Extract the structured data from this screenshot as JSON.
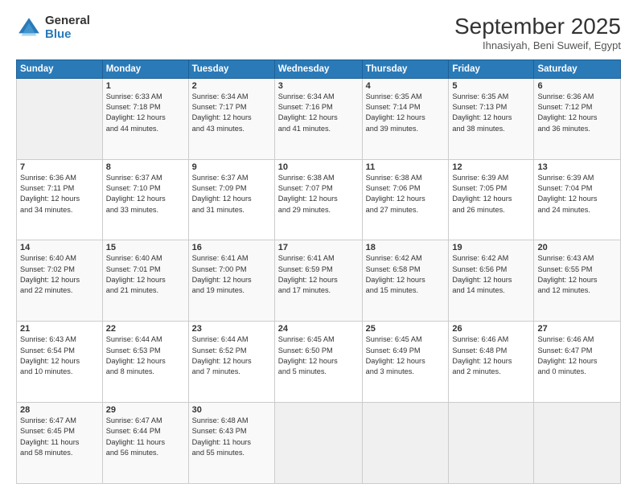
{
  "logo": {
    "general": "General",
    "blue": "Blue"
  },
  "header": {
    "month": "September 2025",
    "subtitle": "Ihnasiyah, Beni Suweif, Egypt"
  },
  "days": [
    "Sunday",
    "Monday",
    "Tuesday",
    "Wednesday",
    "Thursday",
    "Friday",
    "Saturday"
  ],
  "weeks": [
    [
      {
        "num": "",
        "text": ""
      },
      {
        "num": "1",
        "text": "Sunrise: 6:33 AM\nSunset: 7:18 PM\nDaylight: 12 hours\nand 44 minutes."
      },
      {
        "num": "2",
        "text": "Sunrise: 6:34 AM\nSunset: 7:17 PM\nDaylight: 12 hours\nand 43 minutes."
      },
      {
        "num": "3",
        "text": "Sunrise: 6:34 AM\nSunset: 7:16 PM\nDaylight: 12 hours\nand 41 minutes."
      },
      {
        "num": "4",
        "text": "Sunrise: 6:35 AM\nSunset: 7:14 PM\nDaylight: 12 hours\nand 39 minutes."
      },
      {
        "num": "5",
        "text": "Sunrise: 6:35 AM\nSunset: 7:13 PM\nDaylight: 12 hours\nand 38 minutes."
      },
      {
        "num": "6",
        "text": "Sunrise: 6:36 AM\nSunset: 7:12 PM\nDaylight: 12 hours\nand 36 minutes."
      }
    ],
    [
      {
        "num": "7",
        "text": "Sunrise: 6:36 AM\nSunset: 7:11 PM\nDaylight: 12 hours\nand 34 minutes."
      },
      {
        "num": "8",
        "text": "Sunrise: 6:37 AM\nSunset: 7:10 PM\nDaylight: 12 hours\nand 33 minutes."
      },
      {
        "num": "9",
        "text": "Sunrise: 6:37 AM\nSunset: 7:09 PM\nDaylight: 12 hours\nand 31 minutes."
      },
      {
        "num": "10",
        "text": "Sunrise: 6:38 AM\nSunset: 7:07 PM\nDaylight: 12 hours\nand 29 minutes."
      },
      {
        "num": "11",
        "text": "Sunrise: 6:38 AM\nSunset: 7:06 PM\nDaylight: 12 hours\nand 27 minutes."
      },
      {
        "num": "12",
        "text": "Sunrise: 6:39 AM\nSunset: 7:05 PM\nDaylight: 12 hours\nand 26 minutes."
      },
      {
        "num": "13",
        "text": "Sunrise: 6:39 AM\nSunset: 7:04 PM\nDaylight: 12 hours\nand 24 minutes."
      }
    ],
    [
      {
        "num": "14",
        "text": "Sunrise: 6:40 AM\nSunset: 7:02 PM\nDaylight: 12 hours\nand 22 minutes."
      },
      {
        "num": "15",
        "text": "Sunrise: 6:40 AM\nSunset: 7:01 PM\nDaylight: 12 hours\nand 21 minutes."
      },
      {
        "num": "16",
        "text": "Sunrise: 6:41 AM\nSunset: 7:00 PM\nDaylight: 12 hours\nand 19 minutes."
      },
      {
        "num": "17",
        "text": "Sunrise: 6:41 AM\nSunset: 6:59 PM\nDaylight: 12 hours\nand 17 minutes."
      },
      {
        "num": "18",
        "text": "Sunrise: 6:42 AM\nSunset: 6:58 PM\nDaylight: 12 hours\nand 15 minutes."
      },
      {
        "num": "19",
        "text": "Sunrise: 6:42 AM\nSunset: 6:56 PM\nDaylight: 12 hours\nand 14 minutes."
      },
      {
        "num": "20",
        "text": "Sunrise: 6:43 AM\nSunset: 6:55 PM\nDaylight: 12 hours\nand 12 minutes."
      }
    ],
    [
      {
        "num": "21",
        "text": "Sunrise: 6:43 AM\nSunset: 6:54 PM\nDaylight: 12 hours\nand 10 minutes."
      },
      {
        "num": "22",
        "text": "Sunrise: 6:44 AM\nSunset: 6:53 PM\nDaylight: 12 hours\nand 8 minutes."
      },
      {
        "num": "23",
        "text": "Sunrise: 6:44 AM\nSunset: 6:52 PM\nDaylight: 12 hours\nand 7 minutes."
      },
      {
        "num": "24",
        "text": "Sunrise: 6:45 AM\nSunset: 6:50 PM\nDaylight: 12 hours\nand 5 minutes."
      },
      {
        "num": "25",
        "text": "Sunrise: 6:45 AM\nSunset: 6:49 PM\nDaylight: 12 hours\nand 3 minutes."
      },
      {
        "num": "26",
        "text": "Sunrise: 6:46 AM\nSunset: 6:48 PM\nDaylight: 12 hours\nand 2 minutes."
      },
      {
        "num": "27",
        "text": "Sunrise: 6:46 AM\nSunset: 6:47 PM\nDaylight: 12 hours\nand 0 minutes."
      }
    ],
    [
      {
        "num": "28",
        "text": "Sunrise: 6:47 AM\nSunset: 6:45 PM\nDaylight: 11 hours\nand 58 minutes."
      },
      {
        "num": "29",
        "text": "Sunrise: 6:47 AM\nSunset: 6:44 PM\nDaylight: 11 hours\nand 56 minutes."
      },
      {
        "num": "30",
        "text": "Sunrise: 6:48 AM\nSunset: 6:43 PM\nDaylight: 11 hours\nand 55 minutes."
      },
      {
        "num": "",
        "text": ""
      },
      {
        "num": "",
        "text": ""
      },
      {
        "num": "",
        "text": ""
      },
      {
        "num": "",
        "text": ""
      }
    ]
  ]
}
